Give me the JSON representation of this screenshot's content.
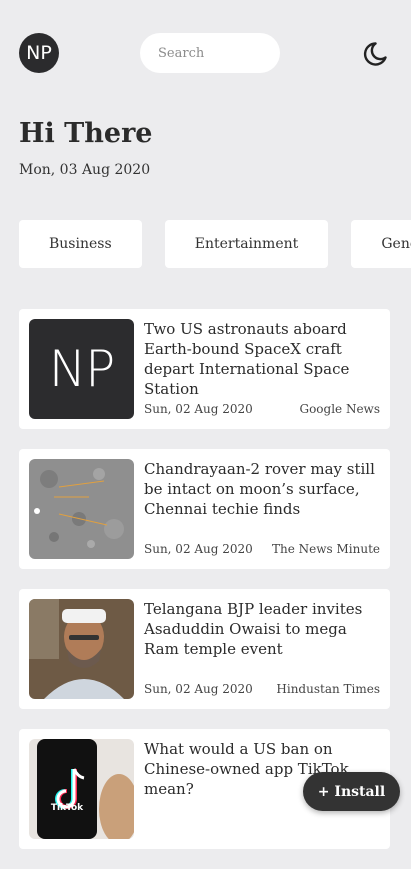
{
  "header": {
    "logo_text": "NP",
    "search_placeholder": "Search",
    "theme_icon": "moon-icon"
  },
  "greeting": "Hi There",
  "date": "Mon, 03 Aug 2020",
  "categories": [
    "Business",
    "Entertainment",
    "General"
  ],
  "articles": [
    {
      "title": "Two US astronauts aboard Earth-bound SpaceX craft depart International Space Station",
      "date": "Sun, 02 Aug 2020",
      "source": "Google News",
      "thumb_text": "NP"
    },
    {
      "title": "Chandrayaan-2 rover may still be intact on moon’s surface, Chennai techie finds",
      "date": "Sun, 02 Aug 2020",
      "source": "The News Minute"
    },
    {
      "title": "Telangana BJP leader invites Asaduddin Owaisi to mega Ram temple event",
      "date": "Sun, 02 Aug 2020",
      "source": "Hindustan Times"
    },
    {
      "title": "What would a US ban on Chinese-owned app TikTok mean?",
      "thumb_text": "TikTok"
    }
  ],
  "install_button": "+ Install",
  "colors": {
    "background": "#ececee",
    "card": "#ffffff",
    "logo": "#2b2b2d",
    "install": "#333333"
  }
}
